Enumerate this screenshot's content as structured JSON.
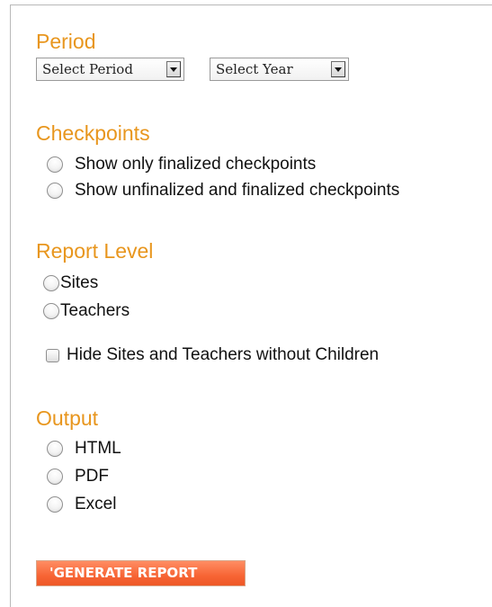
{
  "period": {
    "heading": "Period",
    "period_select": {
      "selected": "Select Period"
    },
    "year_select": {
      "selected": "Select Year"
    }
  },
  "checkpoints": {
    "heading": "Checkpoints",
    "options": [
      {
        "label": "Show only finalized checkpoints",
        "checked": false
      },
      {
        "label": "Show unfinalized and finalized checkpoints",
        "checked": false
      }
    ]
  },
  "report_level": {
    "heading": "Report Level",
    "options": [
      {
        "label": "Sites",
        "checked": false
      },
      {
        "label": "Teachers",
        "checked": false
      }
    ],
    "hide_checkbox": {
      "label": "Hide Sites and Teachers without Children",
      "checked": false
    }
  },
  "output": {
    "heading": "Output",
    "options": [
      {
        "label": "HTML",
        "checked": false
      },
      {
        "label": "PDF",
        "checked": false
      },
      {
        "label": "Excel",
        "checked": false
      }
    ]
  },
  "generate_button": {
    "label": "'GENERATE REPORT"
  },
  "colors": {
    "heading": "#e8961e",
    "button": "#f76535",
    "panel_border": "#b9b9b9"
  }
}
